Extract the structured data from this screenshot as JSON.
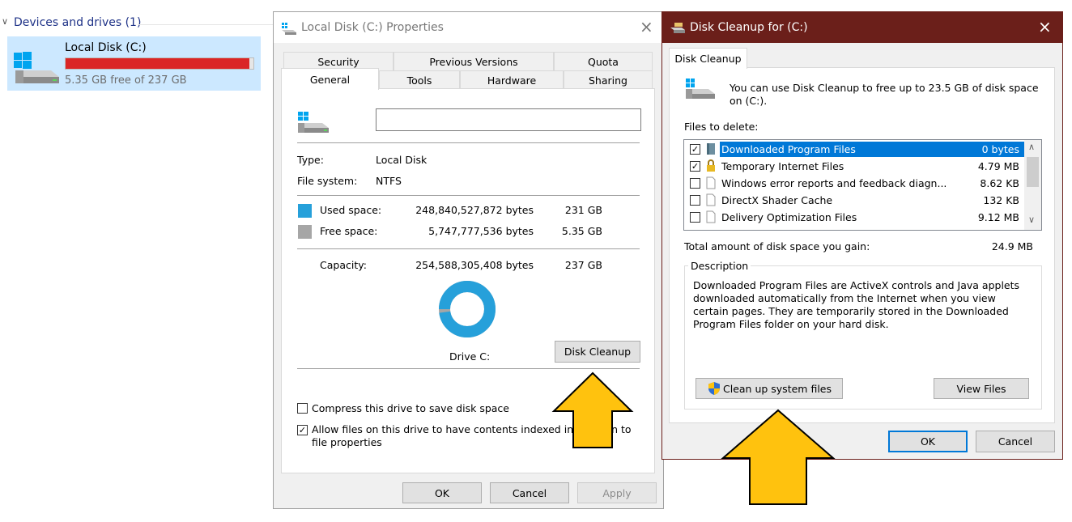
{
  "explorer": {
    "section_title": "Devices and drives (1)",
    "drive_name": "Local Disk (C:)",
    "drive_free": "5.35 GB free of 237 GB",
    "usage_fraction": 0.977,
    "bar_color": "#da2626"
  },
  "properties": {
    "title": "Local Disk (C:) Properties",
    "tabs_row1": [
      "Security",
      "Previous Versions",
      "Quota"
    ],
    "tabs_row2": [
      "General",
      "Tools",
      "Hardware",
      "Sharing"
    ],
    "name_value": "",
    "type_label": "Type:",
    "type_value": "Local Disk",
    "fs_label": "File system:",
    "fs_value": "NTFS",
    "used_label": "Used space:",
    "used_bytes": "248,840,527,872 bytes",
    "used_gb": "231 GB",
    "free_label": "Free space:",
    "free_bytes": "5,747,777,536 bytes",
    "free_gb": "5.35 GB",
    "capacity_label": "Capacity:",
    "capacity_bytes": "254,588,305,408 bytes",
    "capacity_gb": "237 GB",
    "drive_label": "Drive C:",
    "used_fraction": 0.977,
    "used_color": "#26a0da",
    "free_color": "#a6a6a6",
    "disk_cleanup_btn": "Disk Cleanup",
    "compress_label": "Compress this drive to save disk space",
    "compress_checked": false,
    "index_label": "Allow files on this drive to have contents indexed in addition to file properties",
    "index_checked": true,
    "ok": "OK",
    "cancel": "Cancel",
    "apply": "Apply"
  },
  "cleanup": {
    "title": "Disk Cleanup for  (C:)",
    "tab": "Disk Cleanup",
    "intro": "You can use Disk Cleanup to free up to 23.5 GB of disk space on (C:).",
    "files_label": "Files to delete:",
    "files": [
      {
        "name": "Downloaded Program Files",
        "size": "0 bytes",
        "checked": true,
        "selected": true,
        "icon": "folder-icon"
      },
      {
        "name": "Temporary Internet Files",
        "size": "4.79 MB",
        "checked": true,
        "selected": false,
        "icon": "lock-icon"
      },
      {
        "name": "Windows error reports and feedback diagn...",
        "size": "8.62 KB",
        "checked": false,
        "selected": false,
        "icon": "file-icon"
      },
      {
        "name": "DirectX Shader Cache",
        "size": "132 KB",
        "checked": false,
        "selected": false,
        "icon": "file-icon"
      },
      {
        "name": "Delivery Optimization Files",
        "size": "9.12 MB",
        "checked": false,
        "selected": false,
        "icon": "file-icon"
      }
    ],
    "total_label": "Total amount of disk space you gain:",
    "total_value": "24.9 MB",
    "description_title": "Description",
    "description": "Downloaded Program Files are ActiveX controls and Java applets downloaded automatically from the Internet when you view certain pages. They are temporarily stored in the Downloaded Program Files folder on your hard disk.",
    "cleanup_system_btn": "Clean up system files",
    "view_files_btn": "View Files",
    "ok": "OK",
    "cancel": "Cancel",
    "titlebar_color": "#6b1f1a",
    "select_color": "#0078d7"
  },
  "annotation": {
    "arrow_color": "#ffc20e"
  }
}
